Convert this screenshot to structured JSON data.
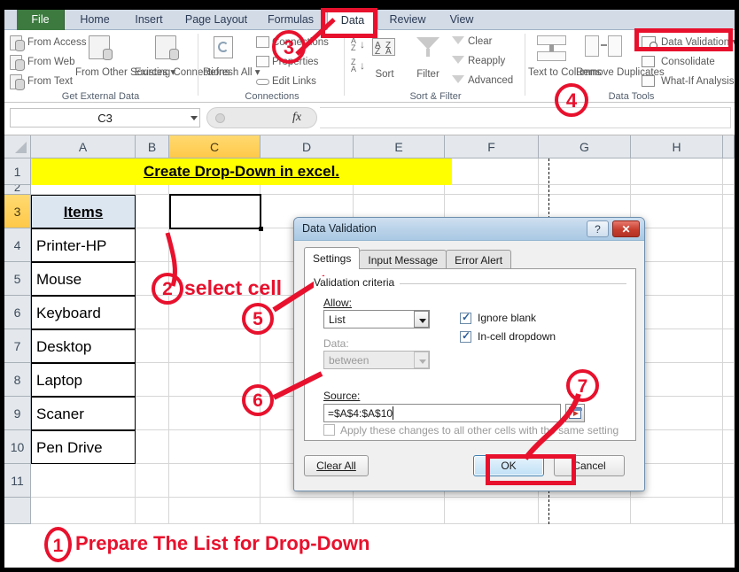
{
  "ribbon": {
    "tabs": [
      {
        "label": "File",
        "kind": "file"
      },
      {
        "label": "Home",
        "kind": "normal"
      },
      {
        "label": "Insert",
        "kind": "normal"
      },
      {
        "label": "Page Layout",
        "kind": "normal"
      },
      {
        "label": "Formulas",
        "kind": "normal"
      },
      {
        "label": "Data",
        "kind": "active"
      },
      {
        "label": "Review",
        "kind": "normal"
      },
      {
        "label": "View",
        "kind": "normal"
      }
    ],
    "groups": [
      {
        "title": "Get External Data",
        "small_commands": [
          "From Access",
          "From Web",
          "From Text"
        ],
        "big_commands": [
          "From Other Sources ▾",
          "Existing Connections"
        ]
      },
      {
        "title": "Connections",
        "small_commands": [
          "Connections",
          "Properties",
          "Edit Links"
        ],
        "big_commands": [
          "Refresh All ▾"
        ]
      },
      {
        "title": "Sort & Filter",
        "small_commands": [
          "Clear",
          "Reapply",
          "Advanced"
        ],
        "big_commands": [
          "Sort",
          "Filter"
        ]
      },
      {
        "title": "Data Tools",
        "small_commands": [
          "Data Validation ▾",
          "Consolidate",
          "What-If Analysis ▾"
        ],
        "big_commands": [
          "Text to Columns",
          "Remove Duplicates"
        ]
      }
    ]
  },
  "formula_bar": {
    "name_box_value": "C3",
    "fx_label": "fx",
    "formula_value": ""
  },
  "grid": {
    "column_headers": [
      "A",
      "B",
      "C",
      "D",
      "E",
      "F",
      "G",
      "H"
    ],
    "selected_column": "C",
    "row_headers": [
      "1",
      "2",
      "3",
      "4",
      "5",
      "6",
      "7",
      "8",
      "9",
      "10",
      "11"
    ],
    "selected_row": "3",
    "title_cell": {
      "ref": "A1",
      "text": "Create Drop-Down in excel.",
      "fill": "#ffff00"
    },
    "items_header": {
      "ref": "A3",
      "text": "Items",
      "fill": "#dce6f1"
    },
    "items": [
      {
        "ref": "A4",
        "text": "Printer-HP"
      },
      {
        "ref": "A5",
        "text": "Mouse"
      },
      {
        "ref": "A6",
        "text": "Keyboard"
      },
      {
        "ref": "A7",
        "text": "Desktop"
      },
      {
        "ref": "A8",
        "text": "Laptop"
      },
      {
        "ref": "A9",
        "text": "Scaner"
      },
      {
        "ref": "A10",
        "text": "Pen Drive"
      }
    ],
    "active_cell": "C3"
  },
  "dialog": {
    "title": "Data Validation",
    "help_glyph": "?",
    "close_glyph": "✕",
    "tabs": [
      {
        "label": "Settings",
        "active": true
      },
      {
        "label": "Input Message",
        "active": false
      },
      {
        "label": "Error Alert",
        "active": false
      }
    ],
    "criteria_legend": "Validation criteria",
    "allow_label": "Allow:",
    "allow_value": "List",
    "data_label": "Data:",
    "data_value": "between",
    "source_label": "Source:",
    "source_value": "=$A$4:$A$10",
    "ignore_blank_label": "Ignore blank",
    "ignore_blank_checked": true,
    "in_cell_dropdown_label": "In-cell dropdown",
    "in_cell_dropdown_checked": true,
    "apply_all_label": "Apply these changes to all other cells with the same setting",
    "apply_all_checked": false,
    "clear_all_label": "Clear All",
    "ok_label": "OK",
    "cancel_label": "Cancel"
  },
  "annotations": {
    "step1_num": "1",
    "step1_text": "Prepare The List for Drop-Down",
    "step2_num": "2",
    "step2_text": "select cell",
    "step3_num": "3",
    "step4_num": "4",
    "step5_num": "5",
    "step6_num": "6",
    "step7_num": "7",
    "accent_color": "#e8112d"
  }
}
